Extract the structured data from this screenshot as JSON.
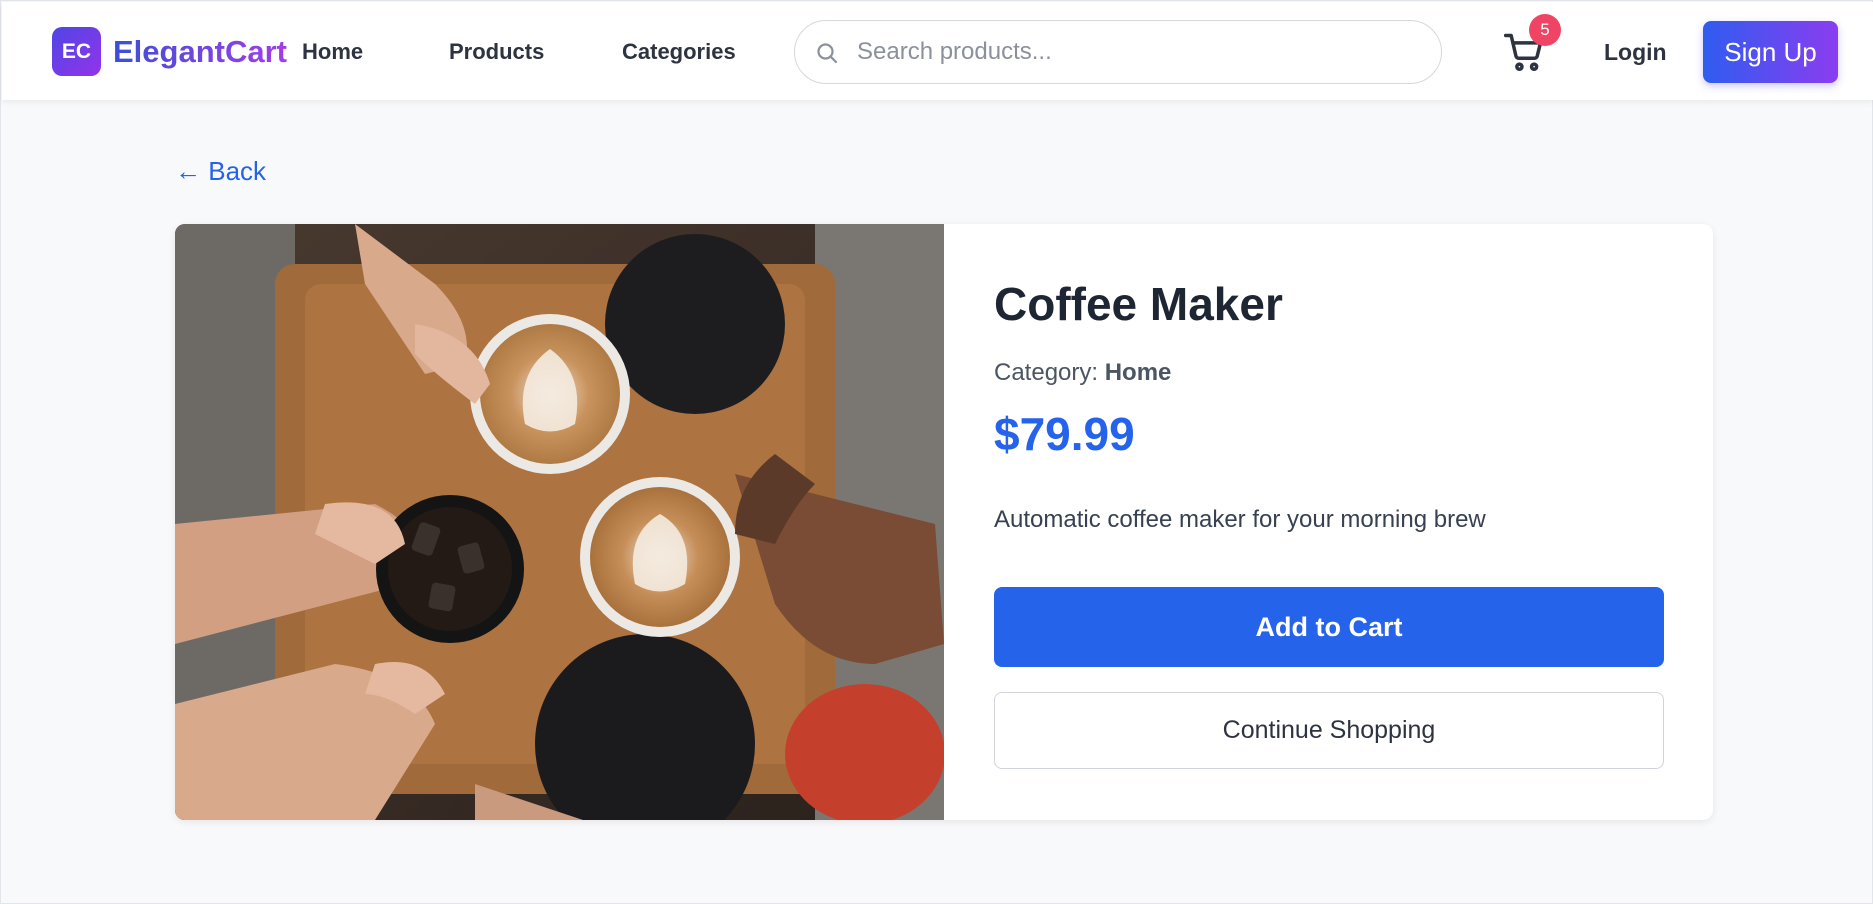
{
  "brand": {
    "badge": "EC",
    "name": "ElegantCart"
  },
  "nav": {
    "items": [
      {
        "label": "Home"
      },
      {
        "label": "Products"
      },
      {
        "label": "Categories"
      }
    ]
  },
  "search": {
    "placeholder": "Search products...",
    "value": ""
  },
  "cart": {
    "count": "5",
    "icon": "cart-icon"
  },
  "auth": {
    "login_label": "Login",
    "signup_label": "Sign Up"
  },
  "back_label": "← Back",
  "product": {
    "title": "Coffee Maker",
    "category_prefix": "Category: ",
    "category": "Home",
    "price": "$79.99",
    "description": "Automatic coffee maker for your morning brew",
    "add_to_cart_label": "Add to Cart",
    "continue_label": "Continue Shopping"
  },
  "colors": {
    "accent": "#2563eb",
    "badge": "#ef4464",
    "brand_start": "#4f46e5",
    "brand_end": "#9333ea"
  }
}
